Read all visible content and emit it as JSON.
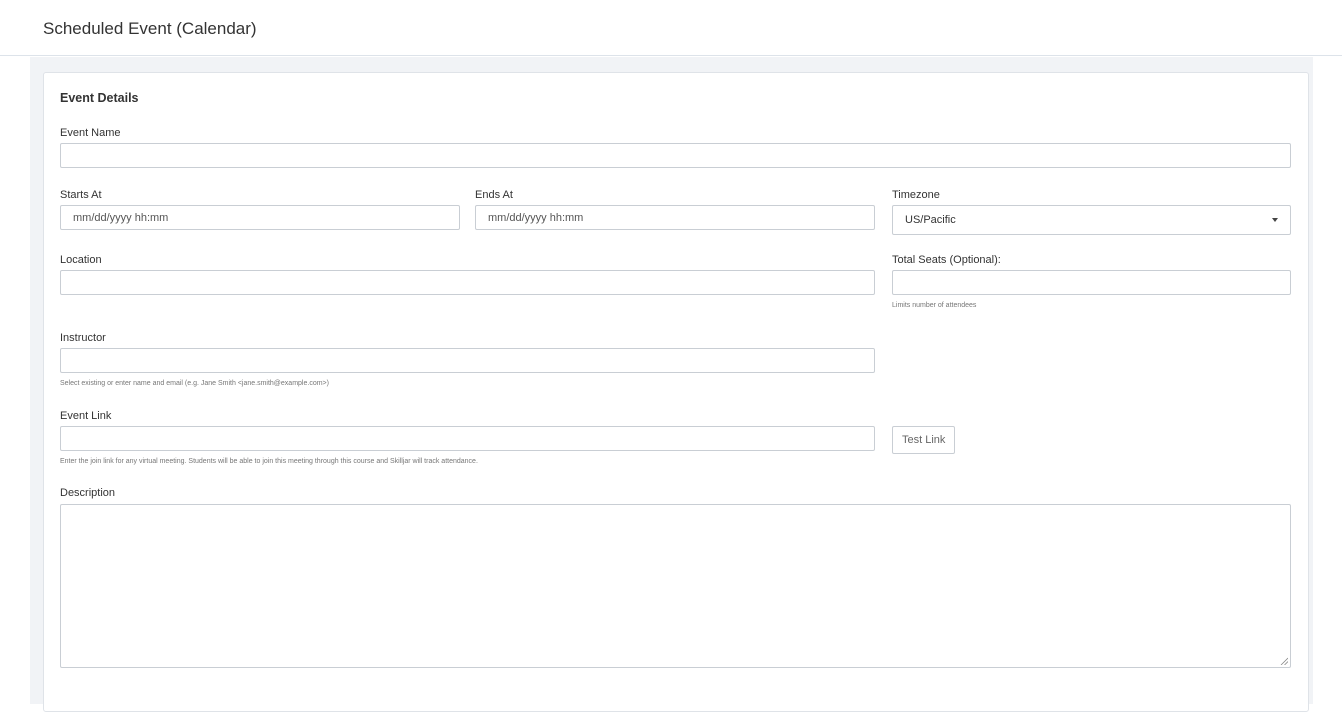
{
  "page": {
    "title": "Scheduled Event (Calendar)"
  },
  "form": {
    "section_title": "Event Details",
    "event_name": {
      "label": "Event Name",
      "value": "",
      "placeholder": ""
    },
    "starts_at": {
      "label": "Starts At",
      "value": "",
      "placeholder": "mm/dd/yyyy hh:mm"
    },
    "ends_at": {
      "label": "Ends At",
      "value": "",
      "placeholder": "mm/dd/yyyy hh:mm"
    },
    "timezone": {
      "label": "Timezone",
      "value": "US/Pacific"
    },
    "location": {
      "label": "Location",
      "value": "",
      "placeholder": ""
    },
    "total_seats": {
      "label": "Total Seats (Optional):",
      "value": "",
      "placeholder": "",
      "help": "Limits number of attendees"
    },
    "instructor": {
      "label": "Instructor",
      "value": "",
      "placeholder": "",
      "help": "Select existing or enter name and email (e.g. Jane Smith <jane.smith@example.com>)"
    },
    "event_link": {
      "label": "Event Link",
      "value": "",
      "placeholder": "",
      "help": "Enter the join link for any virtual meeting. Students will be able to join this meeting through this course and Skilljar will track attendance.",
      "test_button": "Test Link"
    },
    "description": {
      "label": "Description",
      "value": ""
    }
  },
  "icons": {
    "timezone_caret": "caret-down-icon",
    "textarea_resize": "resize-grip-icon"
  },
  "colors": {
    "background": "#f1f3f6",
    "border": "#c9ced4",
    "text": "#333333",
    "help_text": "#777777"
  }
}
